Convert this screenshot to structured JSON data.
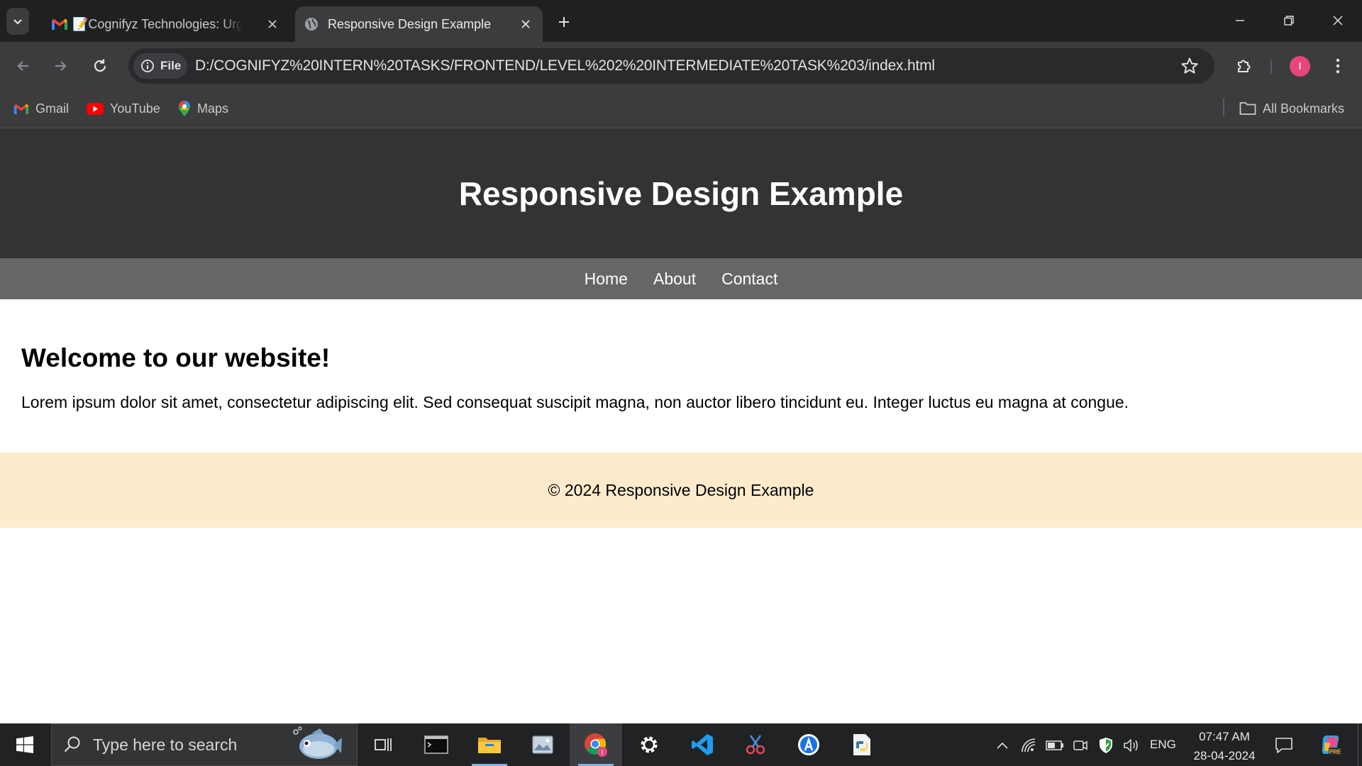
{
  "browser": {
    "tabs": [
      {
        "title": "📝Cognifyz Technologies: Urgent",
        "active": false
      },
      {
        "title": "Responsive Design Example",
        "active": true
      }
    ],
    "address": {
      "scheme_chip": "File",
      "url": "D:/COGNIFYZ%20INTERN%20TASKS/FRONTEND/LEVEL%202%20INTERMEDIATE%20TASK%203/index.html"
    },
    "profile_initial": "I",
    "bookmarks": [
      {
        "label": "Gmail",
        "icon": "gmail-icon"
      },
      {
        "label": "YouTube",
        "icon": "youtube-icon"
      },
      {
        "label": "Maps",
        "icon": "maps-icon"
      }
    ],
    "all_bookmarks_label": "All Bookmarks"
  },
  "page": {
    "header_title": "Responsive Design Example",
    "nav": [
      "Home",
      "About",
      "Contact"
    ],
    "heading": "Welcome to our website!",
    "paragraph": "Lorem ipsum dolor sit amet, consectetur adipiscing elit. Sed consequat suscipit magna, non auctor libero tincidunt eu. Integer luctus eu magna at congue.",
    "footer": "© 2024 Responsive Design Example",
    "colors": {
      "header_bg": "#333333",
      "nav_bg": "#666666",
      "footer_bg": "#feebcc"
    }
  },
  "taskbar": {
    "search_placeholder": "Type here to search",
    "apps": [
      "task-view",
      "terminal",
      "file-explorer",
      "photos",
      "chrome",
      "settings",
      "vscode",
      "snipping-tool",
      "app-store",
      "python"
    ],
    "language": "ENG",
    "time": "07:47 AM",
    "date": "28-04-2024"
  }
}
